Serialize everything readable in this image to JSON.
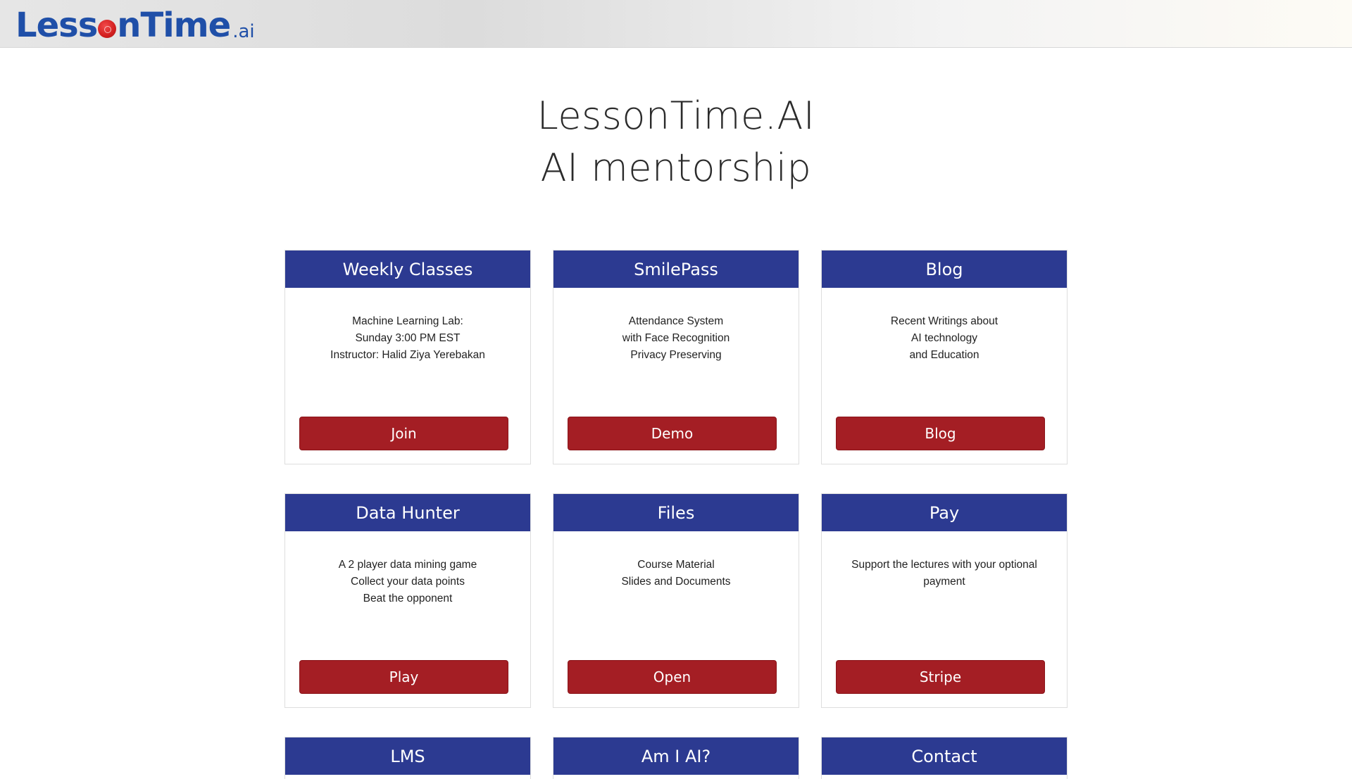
{
  "header": {
    "logo": {
      "word_left": "Less",
      "word_right": "nTime",
      "suffix": ".ai"
    }
  },
  "hero": {
    "line1": "LessonTime.AI",
    "line2": "AI mentorship"
  },
  "cards": [
    {
      "title": "Weekly Classes",
      "lines": [
        "Machine Learning Lab:",
        "Sunday 3:00 PM EST",
        "Instructor: Halid Ziya Yerebakan"
      ],
      "button": "Join"
    },
    {
      "title": "SmilePass",
      "lines": [
        "Attendance System",
        "with Face Recognition",
        "Privacy Preserving"
      ],
      "button": "Demo"
    },
    {
      "title": "Blog",
      "lines": [
        "Recent Writings about",
        "AI technology",
        "and Education"
      ],
      "button": "Blog"
    },
    {
      "title": "Data Hunter",
      "lines": [
        "A 2 player data mining game",
        "Collect your data points",
        "Beat the opponent"
      ],
      "button": "Play"
    },
    {
      "title": "Files",
      "lines": [
        "Course Material",
        "Slides and Documents"
      ],
      "button": "Open"
    },
    {
      "title": "Pay",
      "lines": [
        "Support the lectures with your optional payment"
      ],
      "button": "Stripe"
    }
  ],
  "partial_cards": [
    {
      "title": "LMS"
    },
    {
      "title": "Am I AI?"
    },
    {
      "title": "Contact"
    }
  ],
  "colors": {
    "card_header": "#2c3a91",
    "button": "#a41e24",
    "logo_blue": "#1f4fa8",
    "logo_dot": "#d21f1f"
  }
}
